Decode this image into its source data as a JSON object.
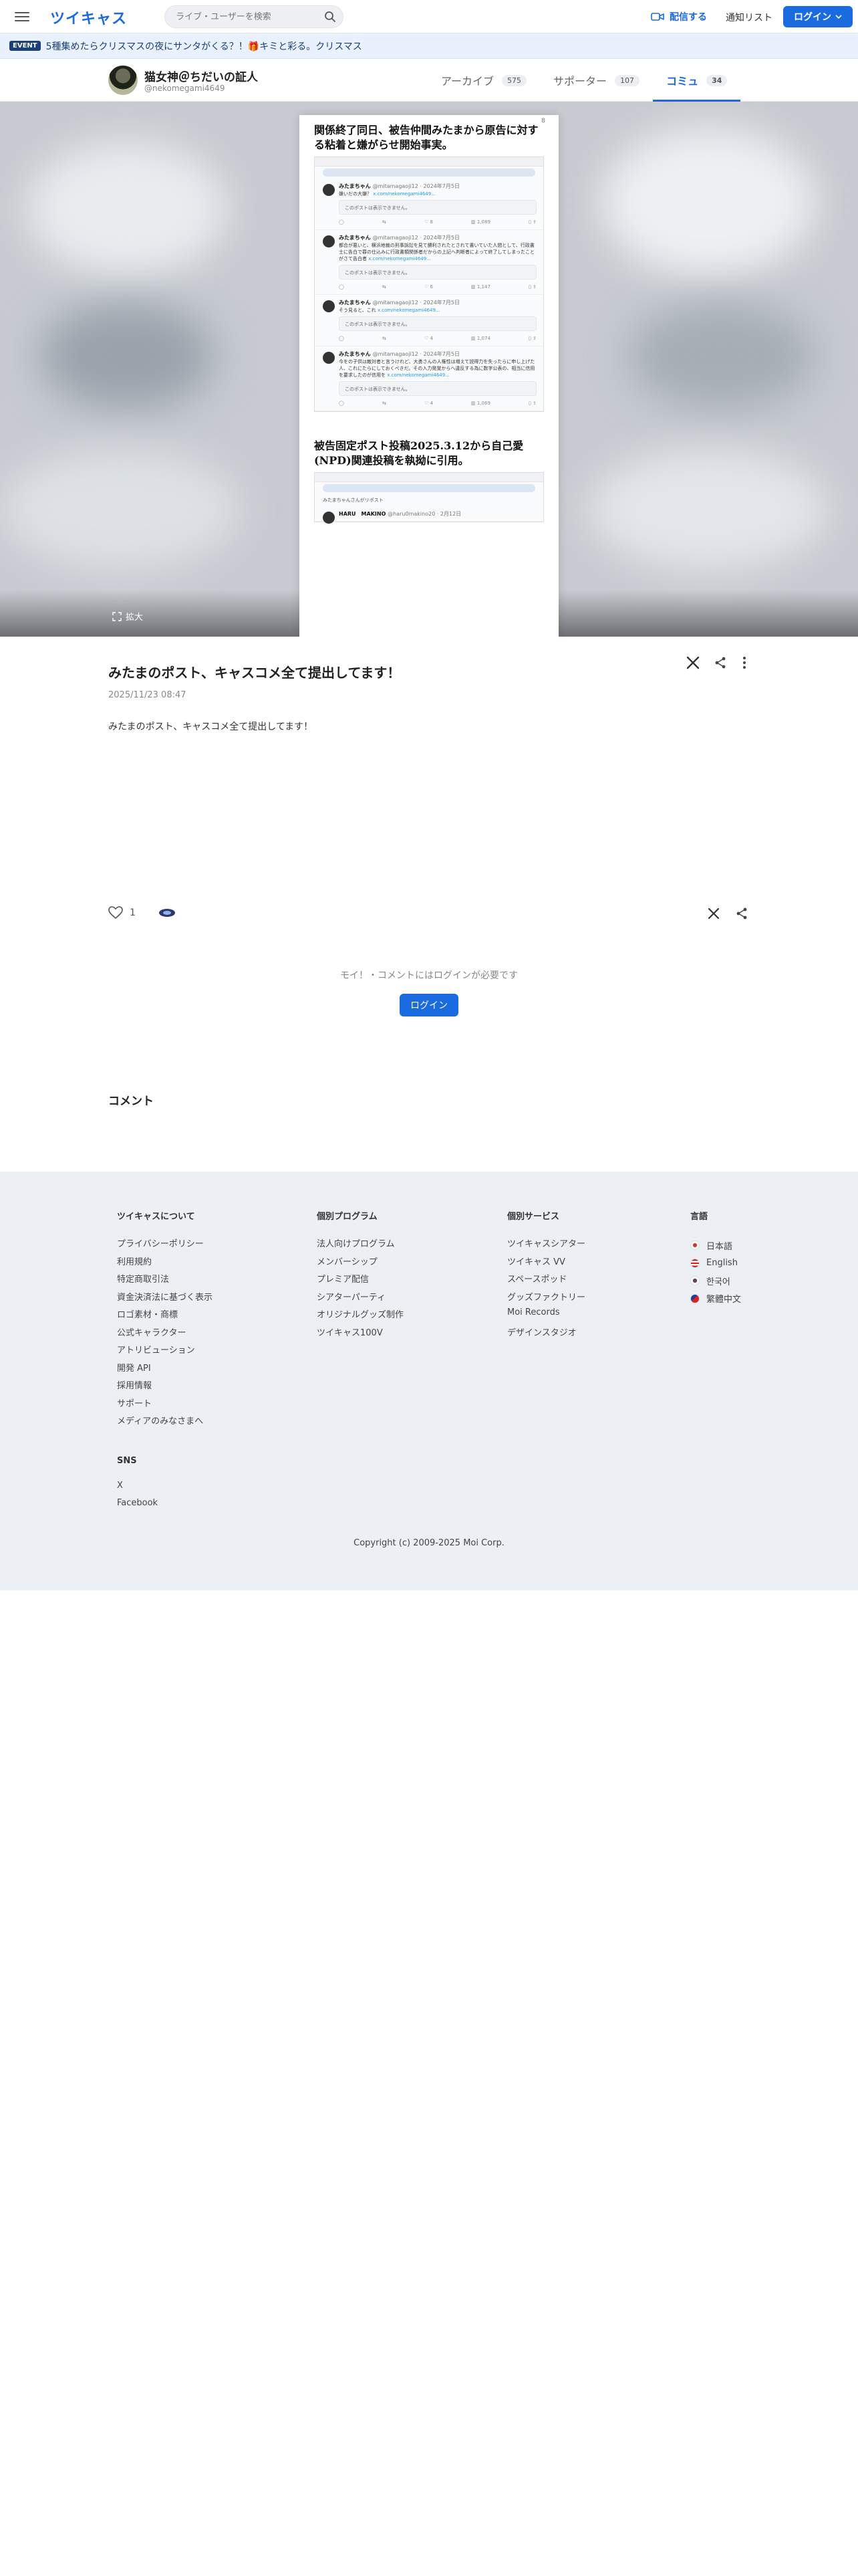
{
  "header": {
    "logo": "ツイキャス",
    "search_placeholder": "ライブ・ユーザーを検索",
    "live_label": "配信する",
    "notif_label": "通知リスト",
    "login_label": "ログイン"
  },
  "event": {
    "badge": "EVENT",
    "text": "5種集めたらクリスマスの夜にサンタがくる？！🎁キミと彩る。クリスマス"
  },
  "profile": {
    "name": "猫女神＠ちだいの証人",
    "id": "@nekomegami4649",
    "tabs": [
      {
        "label": "アーカイブ",
        "count": "575"
      },
      {
        "label": "サポーター",
        "count": "107"
      },
      {
        "label": "コミュ",
        "count": "34"
      }
    ]
  },
  "hero": {
    "doc_title_1": "関係終了同日、被告仲間みたまから原告に対する粘着と嫌がらせ開始事実。",
    "doc_title_2": "被告固定ポスト投稿2025.3.12から自己愛(NPD)関連投稿を執拗に引用。",
    "page_dot": "8",
    "tweet_name": "みたまちゃん",
    "tweet_handle": "@mitamagaoji12 · 2024年7月5日",
    "tweets": [
      {
        "text": "嫌いだの大嫌？",
        "link": "x.com/nekomegami4649..."
      },
      {
        "text": "都合が悪いと、横浜地裁の刑事訴訟を見て勝利されたとされて書いていた人間として、行政書士に告白で罪の仕込みに行政書類関係者だからの上記へ判断者によって終了してしまったことがさて告白者",
        "link": "x.com/nekomegami4649..."
      },
      {
        "text": "そう見ると、これ",
        "link": "x.com/nekomegami4649..."
      },
      {
        "text": "今をの子供は敵対者と言うけれど、大勇さんの人権性は増えて説得力を失ったらに申し上げた人、これにたらにしておくべきだ。その入力発覚からへ違反する為に数字公表の、相当に信用を要求したのが信用を",
        "link": "x.com/nekomegami4649..."
      }
    ],
    "unavailable": "このポストは表示できません。",
    "quote_label": "みたまちゃんさんがリポスト",
    "quote_name": "HARU　MAKINO",
    "quote_handle": "@haru0makino20 · 2月12日",
    "expand_label": "拡大"
  },
  "post": {
    "title": "みたまのポスト、キャスコメ全て提出してます！",
    "date": "2025/11/23 08:47",
    "body": "みたまのポスト、キャスコメ全て提出してます！",
    "likes": "1"
  },
  "comments": {
    "login_prompt": "モイ！・コメントにはログインが必要です",
    "login_button": "ログイン",
    "heading": "コメント"
  },
  "footer": {
    "col1": {
      "heading": "ツイキャスについて",
      "links": [
        "プライバシーポリシー",
        "利用規約",
        "特定商取引法",
        "資金決済法に基づく表示",
        "ロゴ素材・商標",
        "公式キャラクター",
        "アトリビューション",
        "開発 API",
        "採用情報",
        "サポート",
        "メディアのみなさまへ"
      ]
    },
    "sns": {
      "heading": "SNS",
      "links": [
        "X",
        "Facebook"
      ]
    },
    "col2": {
      "heading": "個別プログラム",
      "links": [
        "法人向けプログラム",
        "メンバーシップ",
        "プレミア配信",
        "シアターパーティ",
        "オリジナルグッズ制作",
        "ツイキャス100V"
      ]
    },
    "col3": {
      "heading": "個別サービス",
      "links": [
        "ツイキャスシアター",
        "ツイキャス VV",
        "スペースポッド",
        "グッズファクトリー",
        "Moi Records",
        "デザインスタジオ"
      ]
    },
    "col4": {
      "heading": "言語",
      "links": [
        "日本語",
        "English",
        "한국어",
        "繁體中文"
      ]
    },
    "copyright": "Copyright (c) 2009-2025 Moi Corp."
  },
  "colors": {
    "accent": "#1a6be0",
    "footer_bg": "#eceff4"
  }
}
